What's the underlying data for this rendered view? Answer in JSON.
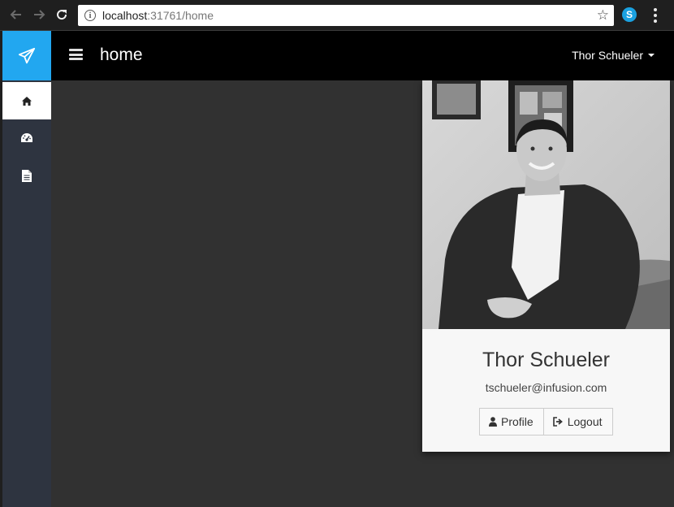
{
  "browser": {
    "url_host": "localhost",
    "url_rest": ":31761/home",
    "back_icon": "arrow-left-icon",
    "forward_icon": "arrow-right-icon",
    "reload_icon": "reload-icon",
    "bookmark_icon": "star-icon",
    "extension_icon": "skype-icon",
    "menu_icon": "kebab-menu-icon"
  },
  "brand": {
    "icon": "paper-plane-icon",
    "color": "#22a7f0"
  },
  "sidebar": {
    "items": [
      {
        "icon": "home-icon",
        "active": true
      },
      {
        "icon": "dashboard-icon",
        "active": false
      },
      {
        "icon": "document-icon",
        "active": false
      }
    ]
  },
  "header": {
    "title": "home",
    "user_name": "Thor Schueler"
  },
  "profile_card": {
    "name": "Thor Schueler",
    "email": "tschueler@infusion.com",
    "profile_label": "Profile",
    "logout_label": "Logout"
  }
}
